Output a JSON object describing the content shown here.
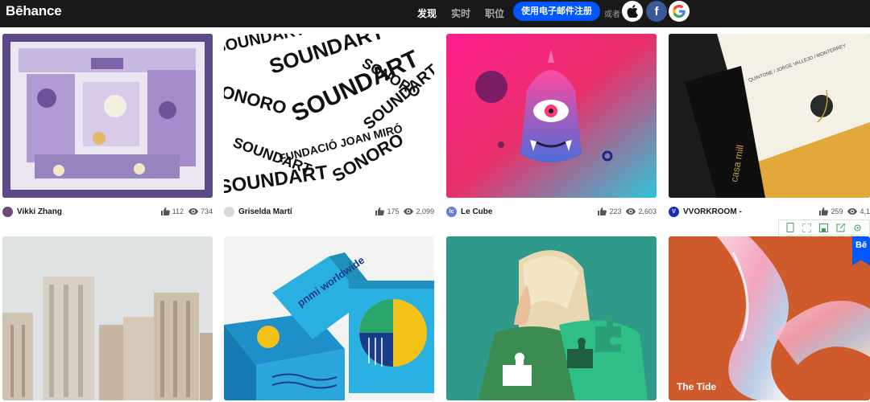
{
  "brand": {
    "logo": "Bēhance"
  },
  "nav": {
    "discover": "发现",
    "live": "实时",
    "jobs": "职位"
  },
  "auth": {
    "signup_email": "使用电子邮件注册",
    "or": "或者"
  },
  "social": {
    "facebook_glyph": "f",
    "google_glyph": "G"
  },
  "cards": [
    {
      "owner": "Vikki Zhang",
      "likes": "112",
      "views": "734"
    },
    {
      "owner": "Griselda Martí",
      "likes": "175",
      "views": "2,099"
    },
    {
      "owner": "Le Cube",
      "likes": "223",
      "views": "2,603",
      "avatar_text": "lc"
    },
    {
      "owner": "VVORKROOM -",
      "likes": "259",
      "views": "4,1",
      "avatar_text": "V"
    },
    {
      "owner": "",
      "likes": "",
      "views": ""
    },
    {
      "owner": "",
      "likes": "",
      "views": ""
    },
    {
      "owner": "",
      "likes": "",
      "views": ""
    },
    {
      "title": "The Tide",
      "badge": "Bē"
    }
  ],
  "thumb_text": {
    "sound_art": "SOUNDART",
    "fundacio": "FUNDACIÓ JOAN MIRÓ",
    "sonoro": "SONORO",
    "casa_mill": "casa mill",
    "quintone": "QUINTONE / JORGE VALLEJO / MONTERREY",
    "pnmi": "pnmi worldwide"
  },
  "colors": {
    "topbar": "#191919",
    "accent": "#0057ff"
  }
}
